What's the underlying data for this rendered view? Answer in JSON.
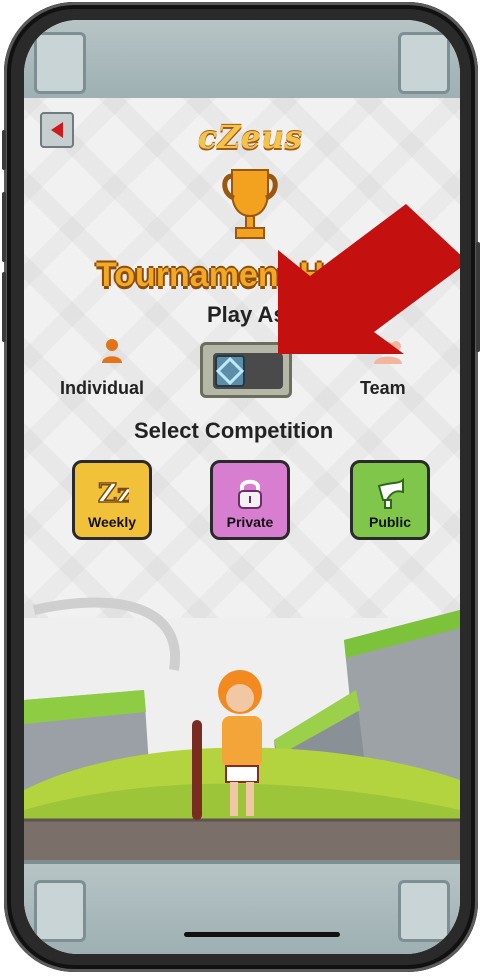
{
  "app": {
    "logo_text": "cZeus",
    "title": "Tournament Hub",
    "play_as_label": "Play As",
    "individual_label": "Individual",
    "team_label": "Team",
    "select_competition_label": "Select Competition",
    "competition_tiles": [
      {
        "label": "Weekly",
        "color": "#f2c13a",
        "icon": "zz-icon"
      },
      {
        "label": "Private",
        "color": "#d77ed0",
        "icon": "lock-icon"
      },
      {
        "label": "Public",
        "color": "#80c64b",
        "icon": "horn-icon"
      }
    ]
  },
  "colors": {
    "accent_orange": "#f1a926",
    "highlight_red": "#c51010"
  },
  "icons": {
    "back": "back-triangle-icon",
    "trophy": "trophy-icon",
    "individual": "person-icon",
    "team": "team-icon",
    "annotation": "red-arrow-icon"
  }
}
